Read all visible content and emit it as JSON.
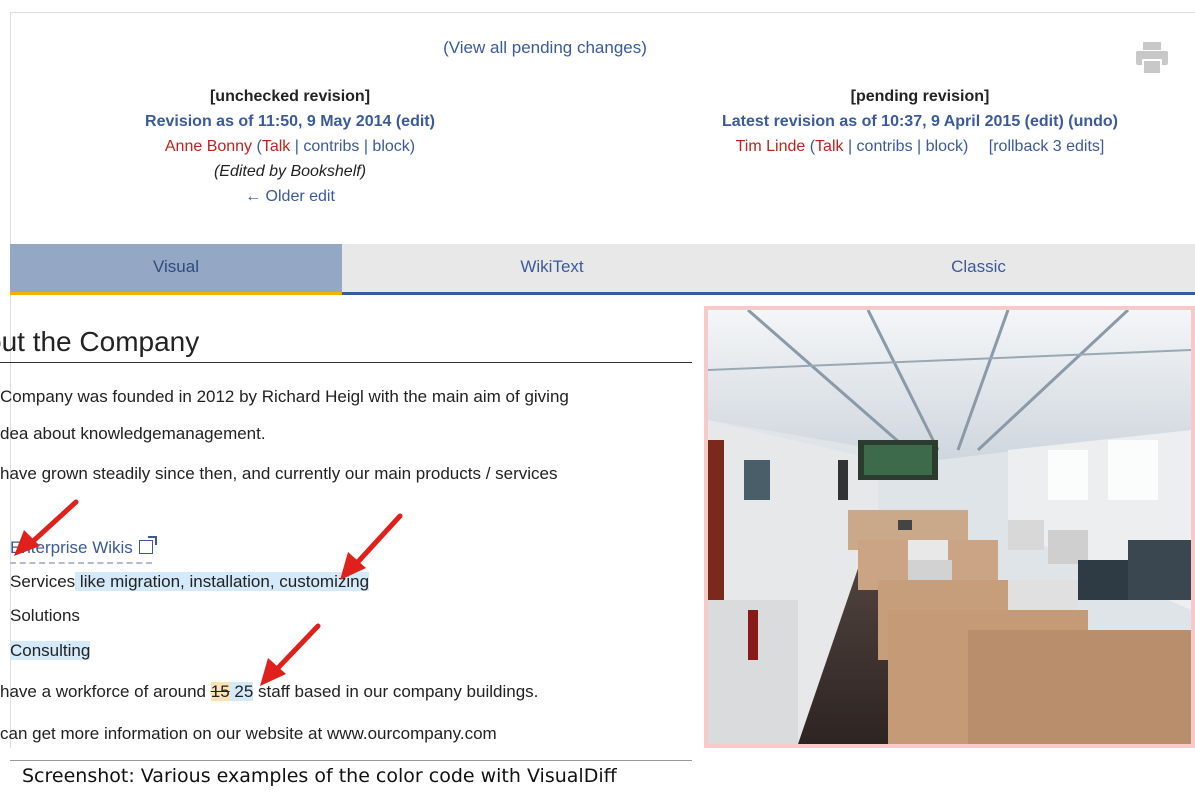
{
  "header": {
    "pending_link": "(View all pending changes)",
    "print_icon": "printer-icon"
  },
  "left_revision": {
    "status": "[unchecked revision]",
    "title": "Revision as of 11:50, 9 May 2014",
    "edit_link": "(edit)",
    "user": "Anne Bonny",
    "open_paren": " (",
    "talk": "Talk",
    "sep1": " | ",
    "contribs": "contribs",
    "sep2": " | ",
    "block": "block",
    "close_paren": ")",
    "edited_by": "(Edited by Bookshelf)",
    "older_edit": "← Older edit"
  },
  "right_revision": {
    "status": "[pending revision]",
    "title": "Latest revision as of 10:37, 9 April 2015",
    "edit_link": "(edit)",
    "undo_link": "(undo)",
    "user": "Tim Linde",
    "open_paren": " (",
    "talk": "Talk",
    "sep1": " | ",
    "contribs": "contribs",
    "sep2": " | ",
    "block": "block",
    "close_paren": ")",
    "rollback": "[rollback 3 edits]"
  },
  "tabs": [
    "Visual",
    "WikiText",
    "Classic"
  ],
  "content": {
    "heading": "out the Company",
    "p1_line1": "Company was founded in 2012 by Richard Heigl with the main aim of giving",
    "p1_line2": "dea about knowledgemanagement.",
    "p2_line1": "have grown steadily since then, and currently our main products / services",
    "list_item1": "Enterprise Wikis",
    "list_item2_plain": "Services",
    "list_item2_added": " like migration, installation, customizing",
    "list_item3": "Solutions",
    "list_item4": "Consulting",
    "workforce_before": "have a workforce of around ",
    "workforce_deleted": "15",
    "workforce_inserted": " 25",
    "workforce_after": " staff based in our company buildings.",
    "website_line": "can get more information on our website at www.ourcompany.com"
  },
  "caption": "Screenshot: Various examples of the color code with VisualDiff",
  "colors": {
    "link_blue": "#3a5a9a",
    "user_red": "#c0221c",
    "insert_highlight": "#d4e9f9",
    "delete_highlight": "#fbe3b6",
    "active_tab": "#94a7c5",
    "tab_accent": "#f0b400",
    "arrow_red": "#e0201a"
  }
}
